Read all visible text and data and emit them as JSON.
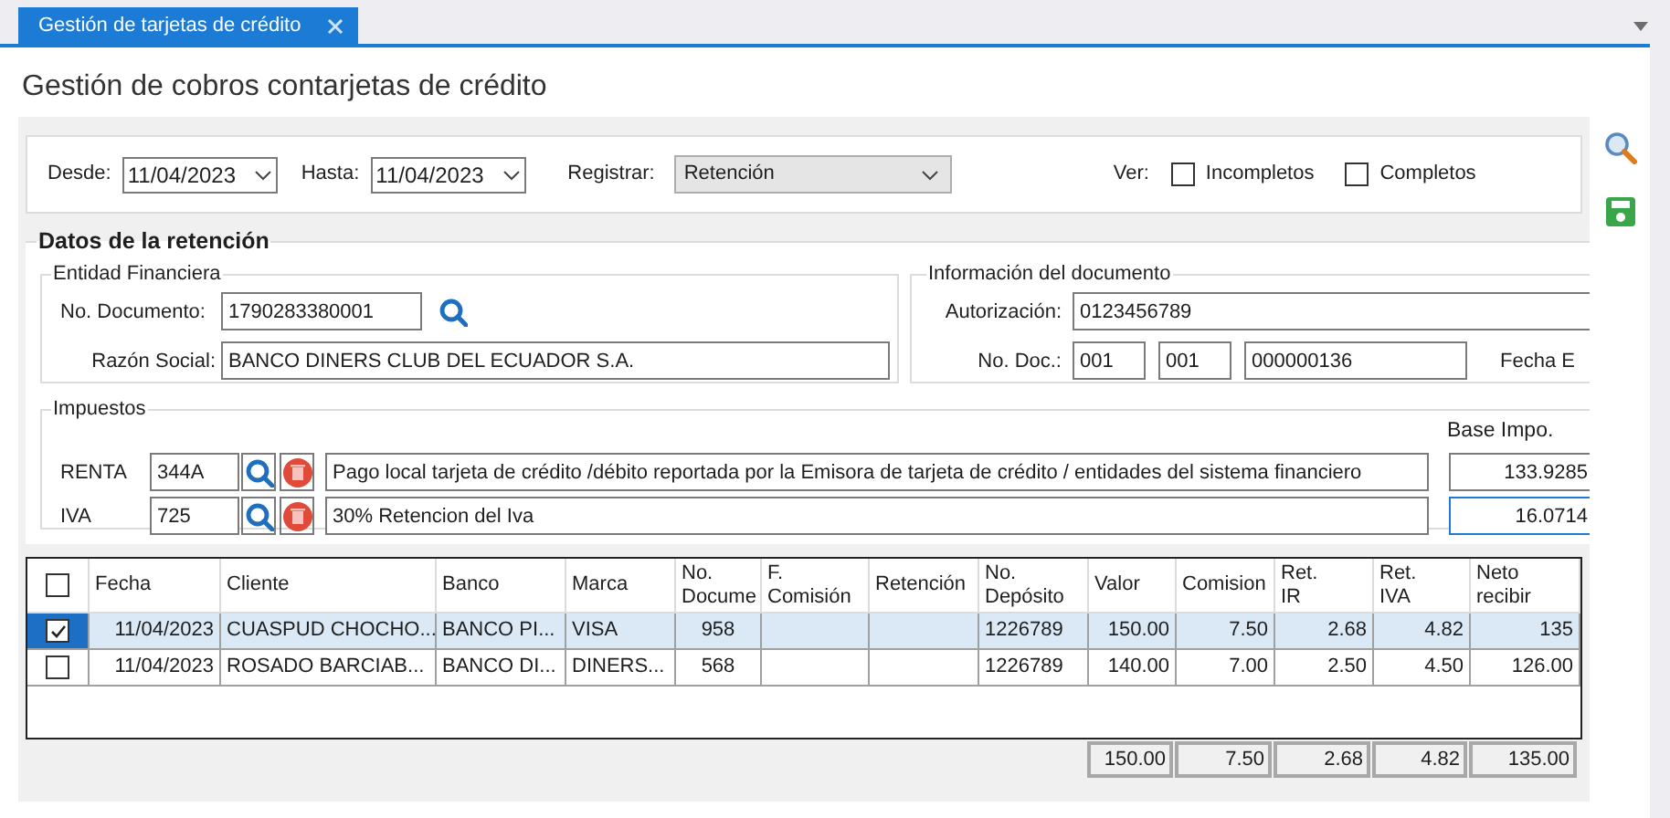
{
  "tab": {
    "label": "Gestión de tarjetas de crédito",
    "selected": true
  },
  "page_title": "Gestión de cobros contarjetas de crédito",
  "filters": {
    "desde": {
      "label": "Desde:",
      "value": "11/04/2023"
    },
    "hasta": {
      "label": "Hasta:",
      "value": "11/04/2023"
    },
    "registrar": {
      "label": "Registrar:",
      "value": "Retención"
    },
    "ver_label": "Ver:",
    "options": [
      {
        "label": "Incompletos",
        "checked": false
      },
      {
        "label": "Completos",
        "checked": false
      }
    ]
  },
  "retencion": {
    "title": "Datos de la retención",
    "entidad": {
      "title": "Entidad Financiera",
      "no_documento": {
        "label": "No. Documento:",
        "value": "1790283380001"
      },
      "razon_social": {
        "label": "Razón Social:",
        "value": "BANCO DINERS CLUB DEL ECUADOR S.A."
      }
    },
    "documento": {
      "title": "Información del documento",
      "autorizacion": {
        "label": "Autorización:",
        "value": "0123456789"
      },
      "no_doc": {
        "label": "No. Doc.:",
        "values": [
          "001",
          "001",
          "000000136"
        ]
      },
      "fecha_label": "Fecha E"
    },
    "impuestos": {
      "title": "Impuestos",
      "base_label": "Base Impo.",
      "rows": [
        {
          "label": "RENTA",
          "code": "344A",
          "description": "Pago local tarjeta de crédito /débito reportada por la Emisora de tarjeta de crédito / entidades del sistema financiero",
          "base": "133.9285",
          "focused": false
        },
        {
          "label": "IVA",
          "code": "725",
          "description": "30% Retencion del Iva",
          "base": "16.0714",
          "focused": true
        }
      ]
    }
  },
  "table": {
    "header_checked": false,
    "columns": [
      "Fecha",
      "Cliente",
      "Banco",
      "Marca",
      "No.\nDocume",
      "F.\nComisión",
      "Retención",
      "No.\nDepósito",
      "Valor",
      "Comision",
      "Ret.\nIR",
      "Ret.\nIVA",
      "Neto\nrecibir"
    ],
    "rows": [
      {
        "selected": true,
        "checked": true,
        "cells": [
          "11/04/2023",
          "CUASPUD CHOCHO...",
          "BANCO PI...",
          "VISA",
          "958",
          "",
          "",
          "1226789",
          "150.00",
          "7.50",
          "2.68",
          "4.82",
          "135"
        ]
      },
      {
        "selected": false,
        "checked": false,
        "cells": [
          "11/04/2023",
          "ROSADO BARCIAB...",
          "BANCO DI...",
          "DINERS...",
          "568",
          "",
          "",
          "1226789",
          "140.00",
          "7.00",
          "2.50",
          "4.50",
          "126.00"
        ]
      }
    ],
    "totals": [
      "150.00",
      "7.50",
      "2.68",
      "4.82",
      "135.00"
    ]
  }
}
